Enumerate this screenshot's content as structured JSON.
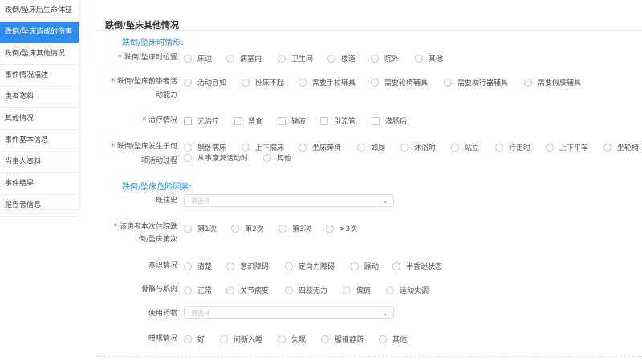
{
  "sidebar": {
    "items": [
      {
        "label": "跌倒/坠床后生命体征"
      },
      {
        "label": "跌倒/坠床造成的伤害"
      },
      {
        "label": "跌倒/坠床其他情况"
      },
      {
        "label": "事件情况描述"
      },
      {
        "label": "患者资料"
      },
      {
        "label": "其他情况"
      },
      {
        "label": "事件基本信息"
      },
      {
        "label": "当事人资料"
      },
      {
        "label": "事件结果"
      },
      {
        "label": "报告者信息"
      }
    ]
  },
  "main": {
    "title": "跌倒/坠床其他情况",
    "section1": "跌倒/坠床时情形:",
    "section2": "跌倒/坠床危险因素:",
    "location": {
      "label": "跌倒/坠床时位置",
      "options": [
        "床边",
        "病室内",
        "卫生间",
        "楼道",
        "院外",
        "其他"
      ]
    },
    "ability": {
      "label1": "跌倒/坠床前患者活",
      "label2": "动能力",
      "options": [
        "活动自如",
        "卧床不起",
        "需要手杖辅具",
        "需要轮椅辅具",
        "需要助行器辅具",
        "需要假肢辅具"
      ]
    },
    "treatment": {
      "label": "治疗情况",
      "options": [
        "无治疗",
        "禁食",
        "输液",
        "引流管",
        "灌肠后"
      ]
    },
    "activity": {
      "label1": "跌倒/坠床发生于何",
      "label2": "项活动过程",
      "options_row1": [
        "躺卧病床",
        "上下病床",
        "坐床旁椅",
        "如厕",
        "沐浴时",
        "站立",
        "行走时",
        "上下平车",
        "坐轮椅"
      ],
      "options_row2": [
        "从事康复活动时",
        "其他"
      ]
    },
    "history": {
      "label": "既往史",
      "placeholder": "请选择"
    },
    "count": {
      "label1": "该患者本次住院跌",
      "label2": "倒/坠床第次",
      "options": [
        "第1次",
        "第2次",
        "第3次",
        ">3次"
      ]
    },
    "consciousness": {
      "label": "意识情况",
      "options": [
        "清楚",
        "意识障碍",
        "定向力障碍",
        "躁动",
        "半昏迷状态"
      ]
    },
    "bone": {
      "label": "骨骼与肌肉",
      "options": [
        "正常",
        "关节病变",
        "四肢无力",
        "偏瘫",
        "运动失调"
      ]
    },
    "medication": {
      "label": "使用药物",
      "placeholder": "请选择"
    },
    "sleep": {
      "label": "睡眠情况",
      "options": [
        "好",
        "间断入睡",
        "失眠",
        "服镇静药",
        "其他"
      ]
    }
  }
}
